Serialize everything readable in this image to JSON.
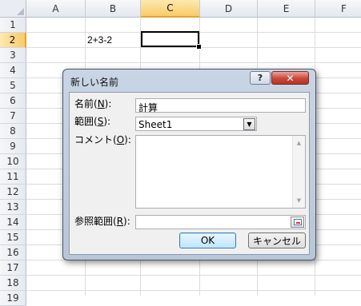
{
  "sheet": {
    "columns": [
      "A",
      "B",
      "C",
      "D",
      "E",
      "F"
    ],
    "active_column": "C",
    "rows": [
      "1",
      "2",
      "3",
      "4",
      "5",
      "6",
      "7",
      "8",
      "9",
      "10",
      "11",
      "12",
      "13",
      "14",
      "15",
      "16",
      "17",
      "18",
      "19"
    ],
    "active_row": "2",
    "cells": {
      "B2": "2+3-2"
    }
  },
  "dialog": {
    "title": "新しい名前",
    "help_symbol": "?",
    "close_symbol": "✕",
    "name": {
      "label": "名前(",
      "accel": "N",
      "label_end": "):",
      "value": "計算"
    },
    "scope": {
      "label": "範囲(",
      "accel": "S",
      "label_end": "):",
      "value": "Sheet1"
    },
    "comment": {
      "label": "コメント(",
      "accel": "O",
      "label_end": "):",
      "value": ""
    },
    "refers_to": {
      "label": "参照範囲(",
      "accel": "R",
      "label_end": "):",
      "value": ""
    },
    "ok_label": "OK",
    "cancel_label": "キャンセル"
  },
  "colors": {
    "active_header": "#f9cb6a",
    "close_button": "#c8483a",
    "dialog_frame": "#b7c6d8"
  },
  "icons": [
    "help-icon",
    "close-icon",
    "dropdown-arrow-icon",
    "scroll-up-icon",
    "scroll-down-icon",
    "collapse-dialog-icon"
  ]
}
